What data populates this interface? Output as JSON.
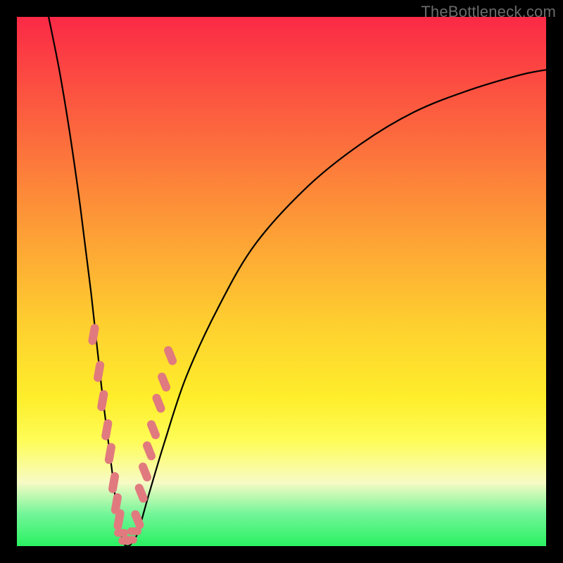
{
  "watermark": "TheBottleneck.com",
  "colors": {
    "gradient_top": "#fb2946",
    "gradient_bottom": "#2af162",
    "curve": "#000000",
    "marker": "#e17a7e",
    "frame_bg": "#000000"
  },
  "chart_data": {
    "type": "line",
    "title": "",
    "xlabel": "",
    "ylabel": "",
    "xlim": [
      0,
      100
    ],
    "ylim": [
      0,
      100
    ],
    "description": "V-shaped bottleneck curve with minimum near x≈20 on a vertical rainbow gradient (red top → green bottom). Salmon pill-shaped markers cluster along the two descending/ascending arms near the trough.",
    "series": [
      {
        "name": "bottleneck-curve",
        "x": [
          6,
          8,
          10,
          12,
          14,
          16,
          18,
          19,
          20,
          21,
          22,
          23,
          25,
          28,
          32,
          38,
          45,
          55,
          65,
          75,
          85,
          95,
          100
        ],
        "y": [
          100,
          90,
          78,
          64,
          48,
          30,
          14,
          6,
          1,
          0,
          1,
          3,
          10,
          20,
          32,
          45,
          57,
          68,
          76,
          82,
          86,
          89,
          90
        ]
      }
    ],
    "markers_left_arm": [
      {
        "x": 14.5,
        "y": 40
      },
      {
        "x": 15.5,
        "y": 33
      },
      {
        "x": 16.2,
        "y": 27.5
      },
      {
        "x": 17.0,
        "y": 22
      },
      {
        "x": 17.6,
        "y": 17.5
      },
      {
        "x": 18.3,
        "y": 12
      },
      {
        "x": 18.8,
        "y": 8
      },
      {
        "x": 19.3,
        "y": 5
      }
    ],
    "markers_right_arm": [
      {
        "x": 22.8,
        "y": 5
      },
      {
        "x": 23.5,
        "y": 10
      },
      {
        "x": 24.2,
        "y": 14
      },
      {
        "x": 25.0,
        "y": 18
      },
      {
        "x": 25.8,
        "y": 22
      },
      {
        "x": 26.8,
        "y": 27
      },
      {
        "x": 27.8,
        "y": 31
      },
      {
        "x": 29.0,
        "y": 36
      }
    ],
    "markers_trough": [
      {
        "x": 19.7,
        "y": 2.5
      },
      {
        "x": 20.5,
        "y": 1.0
      },
      {
        "x": 21.4,
        "y": 1.2
      },
      {
        "x": 22.2,
        "y": 2.8
      }
    ]
  }
}
